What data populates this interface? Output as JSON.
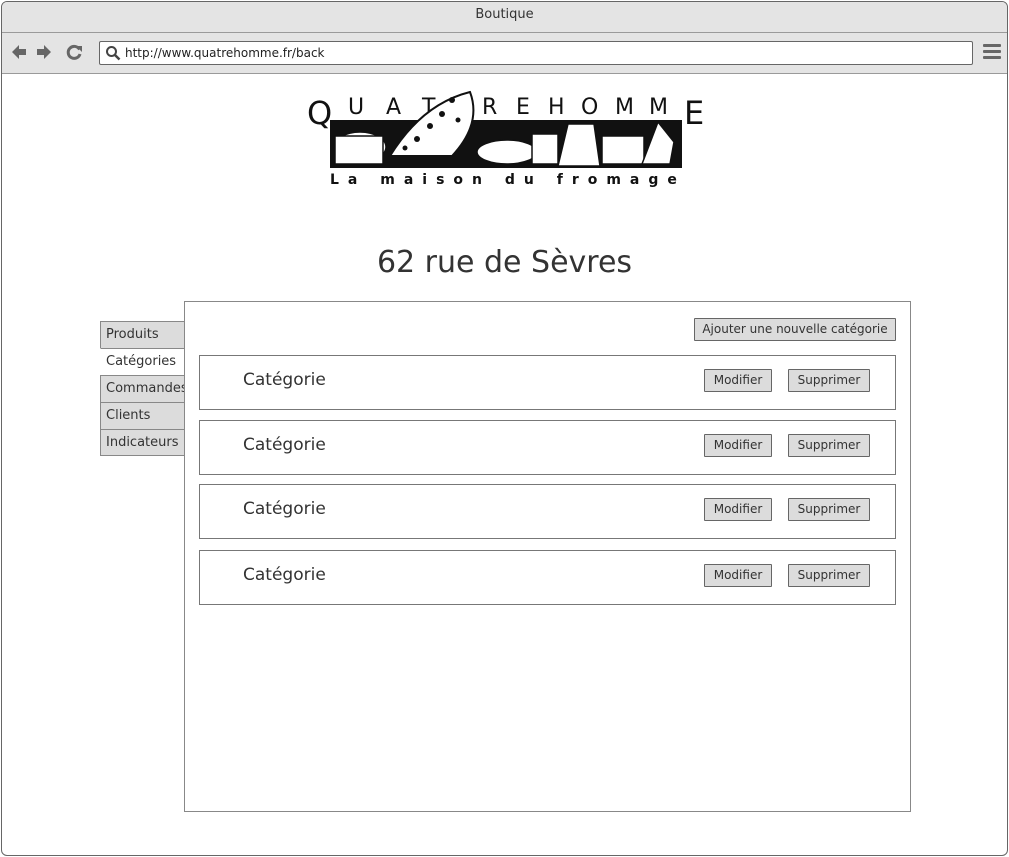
{
  "window": {
    "title": "Boutique"
  },
  "toolbar": {
    "url": "http://www.quatrehomme.fr/back"
  },
  "logo": {
    "name": "QUATREHOMME",
    "tagline": "La maison du fromage"
  },
  "page": {
    "heading": "62 rue de Sèvres"
  },
  "tabs": [
    {
      "label": "Produits"
    },
    {
      "label": "Catégories"
    },
    {
      "label": "Commandes"
    },
    {
      "label": "Clients"
    },
    {
      "label": "Indicateurs"
    }
  ],
  "active_tab": "Catégories",
  "actions": {
    "add_category": "Ajouter une nouvelle catégorie"
  },
  "categories": [
    {
      "name": "Catégorie",
      "modify": "Modifier",
      "delete": "Supprimer"
    },
    {
      "name": "Catégorie",
      "modify": "Modifier",
      "delete": "Supprimer"
    },
    {
      "name": "Catégorie",
      "modify": "Modifier",
      "delete": "Supprimer"
    },
    {
      "name": "Catégorie",
      "modify": "Modifier",
      "delete": "Supprimer"
    }
  ]
}
